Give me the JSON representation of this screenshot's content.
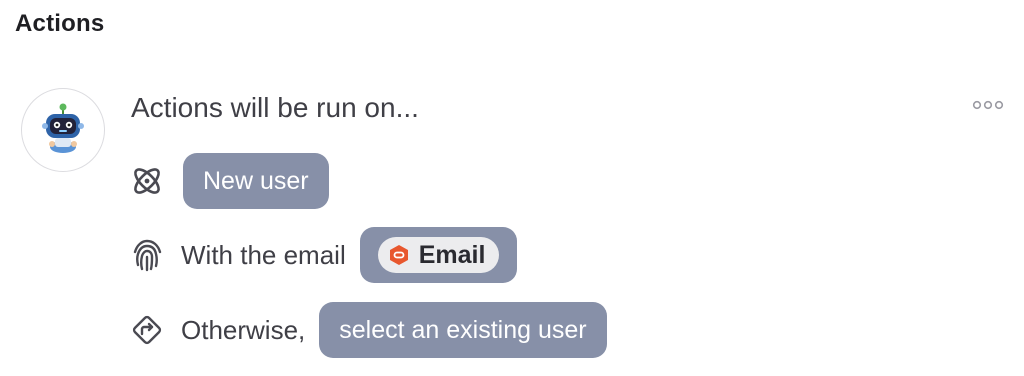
{
  "section": {
    "title": "Actions"
  },
  "card": {
    "avatar_icon": "robot-mascot-icon",
    "headline": "Actions will be run on...",
    "more_icon": "more-options-icon",
    "rows": [
      {
        "icon": "atom-icon",
        "text": "",
        "pill_label": "New user"
      },
      {
        "icon": "fingerprint-icon",
        "text": "With the email",
        "token_icon": "email-app-icon",
        "token_label": "Email"
      },
      {
        "icon": "turn-right-diamond-icon",
        "text": "Otherwise,",
        "pill_label": "select an existing user"
      }
    ]
  },
  "colors": {
    "pill_background": "#8790a8",
    "token_background": "#ececee",
    "token_icon_color": "#e8572e",
    "text_primary": "#3f3f46"
  }
}
